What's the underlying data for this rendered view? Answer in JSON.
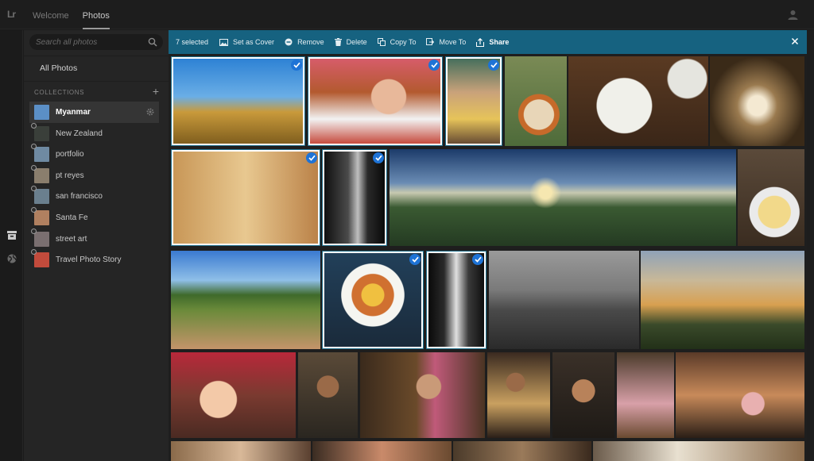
{
  "topbar": {
    "logo": "Lr",
    "tabs": [
      "Welcome",
      "Photos"
    ],
    "active_tab": "Photos"
  },
  "sidebar": {
    "search_placeholder": "Search all photos",
    "all_photos": "All Photos",
    "collections_header": "COLLECTIONS",
    "collections": [
      {
        "name": "Myanmar",
        "active": true,
        "thumb_color": "#5b8fc6"
      },
      {
        "name": "New Zealand",
        "active": false,
        "thumb_color": "#3a3f3a"
      },
      {
        "name": "portfolio",
        "active": false,
        "thumb_color": "#6f8aa2"
      },
      {
        "name": "pt reyes",
        "active": false,
        "thumb_color": "#8a7e6d"
      },
      {
        "name": "san francisco",
        "active": false,
        "thumb_color": "#6a7f8e"
      },
      {
        "name": "Santa Fe",
        "active": false,
        "thumb_color": "#b08060"
      },
      {
        "name": "street art",
        "active": false,
        "thumb_color": "#7a6f70"
      },
      {
        "name": "Travel Photo Story",
        "active": false,
        "thumb_color": "#c24b3c"
      }
    ]
  },
  "selection_bar": {
    "count_label": "7 selected",
    "actions": [
      {
        "label": "Set as Cover",
        "icon": "image-icon"
      },
      {
        "label": "Remove",
        "icon": "remove-circle-icon"
      },
      {
        "label": "Delete",
        "icon": "trash-icon"
      },
      {
        "label": "Copy To",
        "icon": "copy-icon"
      },
      {
        "label": "Move To",
        "icon": "move-icon"
      },
      {
        "label": "Share",
        "icon": "share-icon"
      }
    ]
  },
  "colors": {
    "accent": "#166280",
    "check": "#1e73d6",
    "sidebar_bg": "#252525",
    "app_bg": "#1b1b1b"
  }
}
